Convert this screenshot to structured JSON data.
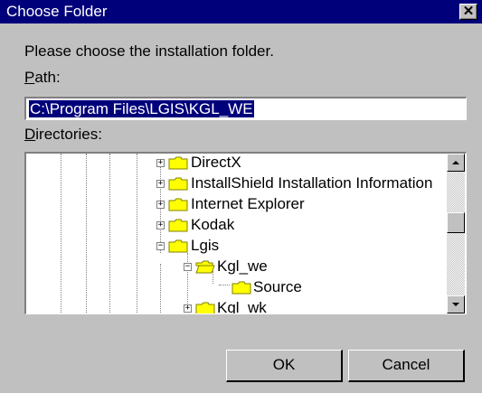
{
  "window": {
    "title": "Choose Folder",
    "close_glyph": "✕"
  },
  "prompt": "Please choose the installation folder.",
  "path": {
    "label_mnemonic": "P",
    "label_rest": "ath:",
    "value": "C:\\Program Files\\LGIS\\KGL_WE"
  },
  "directories": {
    "label_mnemonic": "D",
    "label_rest": "irectories:",
    "items": [
      {
        "label": "DirectX",
        "expander": "+",
        "icon": "folder-closed-icon"
      },
      {
        "label": "InstallShield Installation Information",
        "expander": "+",
        "icon": "folder-closed-icon"
      },
      {
        "label": "Internet Explorer",
        "expander": "+",
        "icon": "folder-closed-icon"
      },
      {
        "label": "Kodak",
        "expander": "+",
        "icon": "folder-closed-icon"
      },
      {
        "label": "Lgis",
        "expander": "−",
        "icon": "folder-closed-icon"
      },
      {
        "label": "Kgl_we",
        "expander": "−",
        "icon": "folder-open-icon"
      },
      {
        "label": "Source",
        "expander": "",
        "icon": "folder-closed-icon"
      },
      {
        "label": "Kgl_wk",
        "expander": "+",
        "icon": "folder-closed-icon"
      }
    ]
  },
  "buttons": {
    "ok": "OK",
    "cancel": "Cancel"
  },
  "colors": {
    "title_bar": "#00007b",
    "face": "#c0c0c0",
    "selection": "#00007b",
    "folder_yellow": "#ffff00"
  }
}
